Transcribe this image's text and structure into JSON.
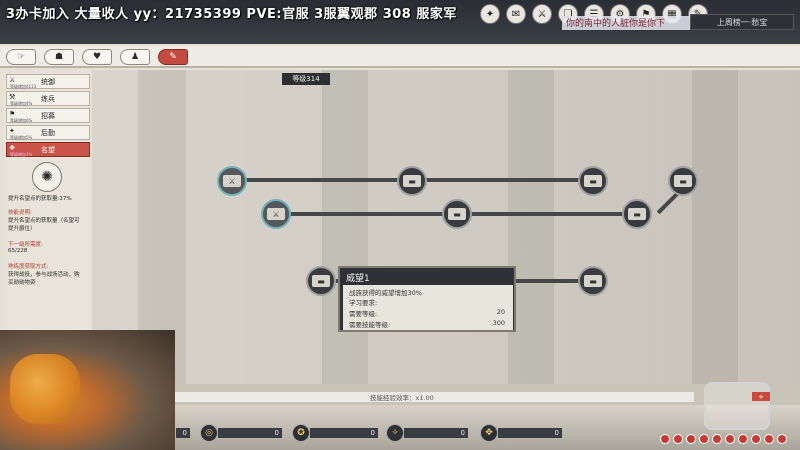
{
  "stream": {
    "banner": "3办卡加入 大量收人 yy：21735399  PVE:官服 3服翼观郡 308 服家军",
    "ticker": "你的南中的人脏你是你下",
    "rank_label": "上周榜一·愁宝"
  },
  "top_icons": [
    "✦",
    "✉",
    "⚔",
    "❏",
    "☰",
    "⚙",
    "⚑",
    "▦",
    "✎"
  ],
  "tabs": [
    {
      "icon": "☞",
      "name": "tab-skills"
    },
    {
      "icon": "☗",
      "name": "tab-equipment"
    },
    {
      "icon": "♥",
      "name": "tab-relations"
    },
    {
      "icon": "♟",
      "name": "tab-units"
    },
    {
      "icon": "✎",
      "name": "tab-battle"
    }
  ],
  "sidebar": {
    "items": [
      {
        "icon": "⚔",
        "sub": "等级增加4113",
        "label": "统御"
      },
      {
        "icon": "⚒",
        "sub": "等级增加4%",
        "label": "练兵"
      },
      {
        "icon": "⚑",
        "sub": "等级增加6%",
        "label": "招募"
      },
      {
        "icon": "✦",
        "sub": "等级增加5%",
        "label": "后勤"
      },
      {
        "icon": "❖",
        "sub": "等级增加1%",
        "label": "名望"
      }
    ],
    "active_index": 4
  },
  "skill_detail": {
    "emblem": "✺",
    "effect": "提升名望点的获取量:17%",
    "desc_title": "技能说明:",
    "desc_1": "提升名望点的获取量（名望可",
    "desc_2": "提升爵位）",
    "next_title": "下一级所需度:",
    "next_value": "65/228",
    "how_title": "熟练度获取方式:",
    "how_1": "获得战役，参与战场活动，购",
    "how_2": "买勋勋物资"
  },
  "tree": {
    "level_tag": "等级314"
  },
  "tooltip": {
    "title": "威望1",
    "effect": "战族获得的威望增加30%",
    "req_title": "学习要求:",
    "req_level_label": "需要等级:",
    "req_level_value": "20",
    "req_skill_label": "需要技能等级:",
    "req_skill_value": "300"
  },
  "bottom": {
    "exp_rate": "技能经验效率：x1.00",
    "slots": [
      {
        "icon": "❂",
        "value": "0"
      },
      {
        "icon": "◎",
        "value": "0"
      },
      {
        "icon": "✪",
        "value": "0"
      },
      {
        "icon": "✧",
        "value": "0"
      },
      {
        "icon": "✥",
        "value": "0"
      }
    ],
    "bonus_button": "+"
  }
}
